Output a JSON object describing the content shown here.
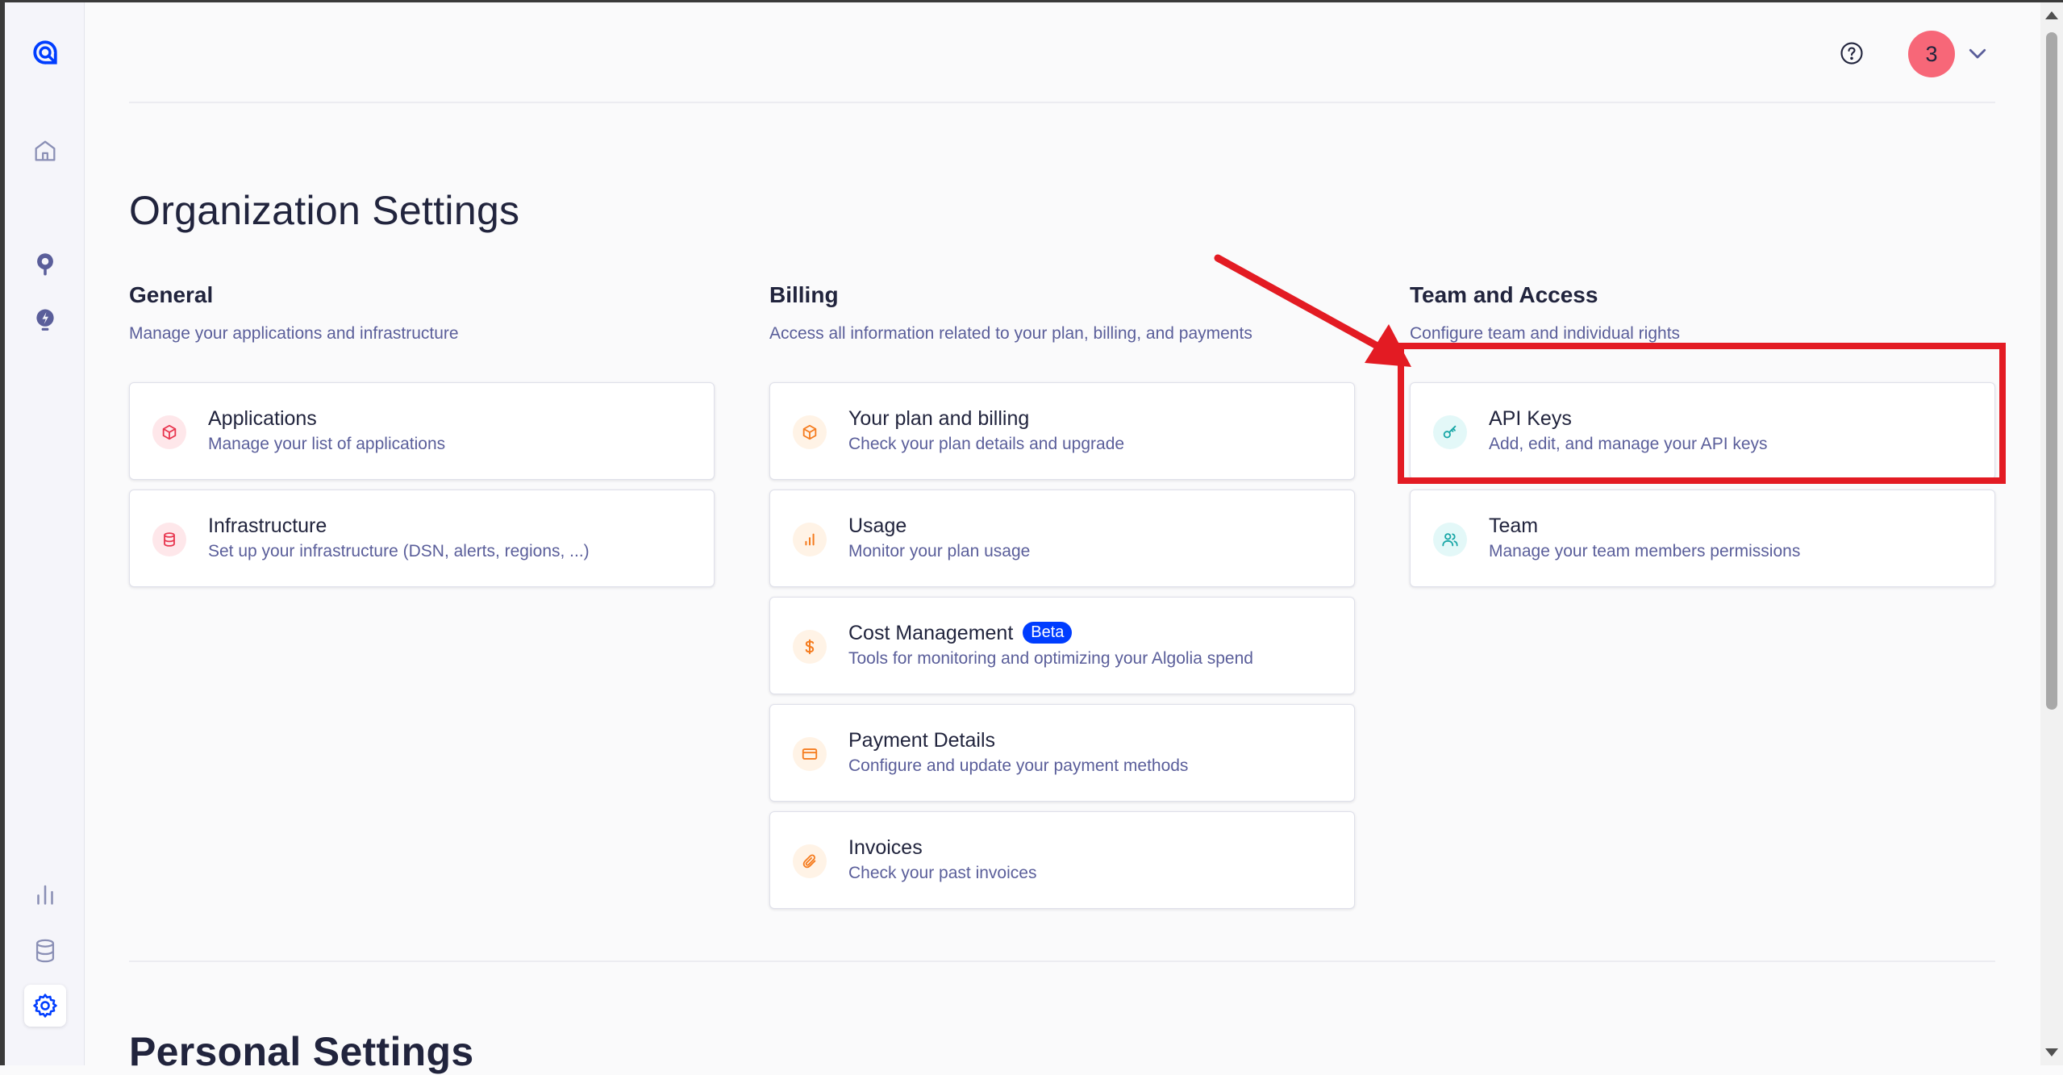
{
  "header": {
    "avatar_initial": "3",
    "help_icon": "help-circle-icon",
    "chevron_icon": "chevron-down-icon"
  },
  "sidebar": {
    "items": [
      {
        "name": "logo",
        "icon": "algolia-logo-icon"
      },
      {
        "name": "home",
        "icon": "home-icon"
      },
      {
        "name": "search",
        "icon": "search-pin-icon"
      },
      {
        "name": "recommend",
        "icon": "lightbulb-icon"
      },
      {
        "name": "analytics",
        "icon": "bar-chart-icon"
      },
      {
        "name": "data",
        "icon": "database-icon"
      },
      {
        "name": "settings",
        "icon": "gear-icon",
        "active": true
      }
    ]
  },
  "page": {
    "title": "Organization Settings",
    "personal_title": "Personal Settings"
  },
  "sections": {
    "general": {
      "title": "General",
      "description": "Manage your applications and infrastructure",
      "cards": [
        {
          "title": "Applications",
          "description": "Manage your list of applications",
          "icon": "cube-icon"
        },
        {
          "title": "Infrastructure",
          "description": "Set up your infrastructure (DSN, alerts, regions, ...)",
          "icon": "database-icon"
        }
      ]
    },
    "billing": {
      "title": "Billing",
      "description": "Access all information related to your plan, billing, and payments",
      "cards": [
        {
          "title": "Your plan and billing",
          "description": "Check your plan details and upgrade",
          "icon": "cube-icon"
        },
        {
          "title": "Usage",
          "description": "Monitor your plan usage",
          "icon": "bar-chart-icon"
        },
        {
          "title": "Cost Management",
          "badge": "Beta",
          "description": "Tools for monitoring and optimizing your Algolia spend",
          "icon": "dollar-icon"
        },
        {
          "title": "Payment Details",
          "description": "Configure and update your payment methods",
          "icon": "credit-card-icon"
        },
        {
          "title": "Invoices",
          "description": "Check your past invoices",
          "icon": "paperclip-icon"
        }
      ]
    },
    "team": {
      "title": "Team and Access",
      "description": "Configure team and individual rights",
      "cards": [
        {
          "title": "API Keys",
          "description": "Add, edit, and manage your API keys",
          "icon": "key-icon"
        },
        {
          "title": "Team",
          "description": "Manage your team members permissions",
          "icon": "users-icon"
        }
      ]
    }
  },
  "colors": {
    "accent": "#003dff",
    "annotation": "#e31b23",
    "avatar": "#f76778",
    "red_icon": "#e8364f",
    "orange_icon": "#f57c1f",
    "teal_icon": "#1aa7a7"
  }
}
